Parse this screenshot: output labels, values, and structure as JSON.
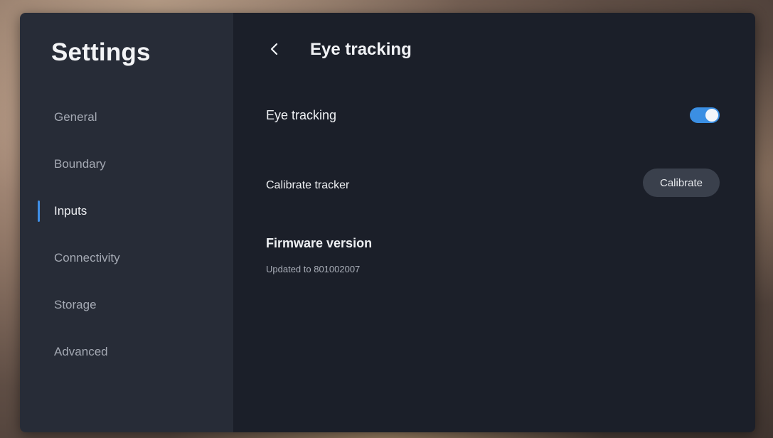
{
  "sidebar": {
    "title": "Settings",
    "items": [
      {
        "label": "General",
        "active": false
      },
      {
        "label": "Boundary",
        "active": false
      },
      {
        "label": "Inputs",
        "active": true
      },
      {
        "label": "Connectivity",
        "active": false
      },
      {
        "label": "Storage",
        "active": false
      },
      {
        "label": "Advanced",
        "active": false
      }
    ]
  },
  "main": {
    "back_icon": "chevron-left-icon",
    "title": "Eye tracking",
    "eye_tracking": {
      "label": "Eye tracking",
      "enabled": true
    },
    "calibrate": {
      "label": "Calibrate tracker",
      "button_label": "Calibrate"
    },
    "firmware": {
      "title": "Firmware version",
      "status": "Updated to 801002007"
    }
  },
  "colors": {
    "accent": "#3b8fe3",
    "sidebar_bg": "#272c37",
    "main_bg": "#1b1f29"
  }
}
